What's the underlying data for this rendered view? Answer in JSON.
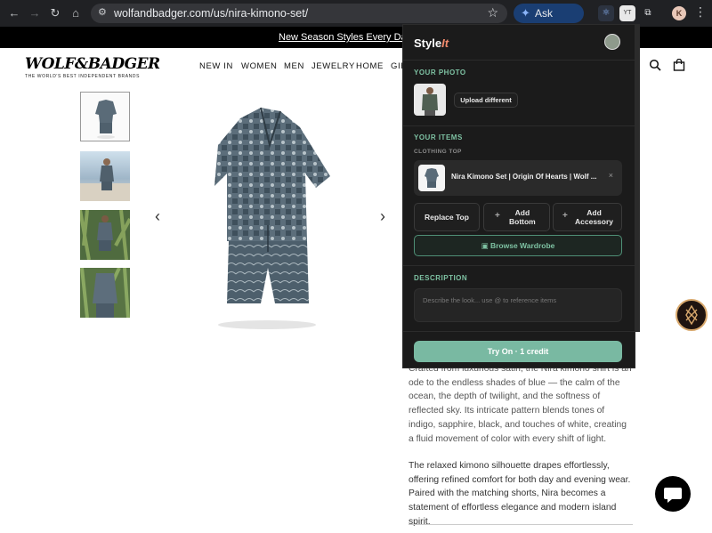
{
  "browser": {
    "url": "wolfandbadger.com/us/nira-kimono-set/",
    "gemini_label": "Ask Gemini",
    "profile_initial": "K",
    "extension_badge": "YT"
  },
  "site": {
    "promo_text": "New Season Styles Every Day. Discover Now",
    "logo_text": "WOLF&BADGER",
    "logo_tagline": "THE WORLD'S BEST INDEPENDENT BRANDS",
    "nav": [
      "NEW IN",
      "WOMEN",
      "MEN",
      "JEWELRY",
      "HOME",
      "GIFTS"
    ],
    "description_p1": "Crafted from luxurious satin, the Nira kimono shirt is an ode to the endless shades of blue — the calm of the ocean, the depth of twilight, and the softness of reflected sky. Its intricate pattern blends tones of indigo, sapphire, black, and touches of white, creating a fluid movement of color with every shift of light.",
    "description_p2": "The relaxed kimono silhouette drapes effortlessly, offering refined comfort for both day and evening wear. Paired with the matching shorts, Nira becomes a statement of effortless elegance and modern island spirit."
  },
  "popup": {
    "brand_prefix": "Style",
    "brand_suffix": "It",
    "your_photo_heading": "YOUR PHOTO",
    "upload_label": "Upload different",
    "your_items_heading": "YOUR ITEMS",
    "clothing_top_label": "CLOTHING TOP",
    "item_title": "Nira Kimono Set | Origin Of Hearts | Wolf ...",
    "replace_top_label": "Replace Top",
    "add_bottom_label": "Add\nBottom",
    "add_accessory_label": "Add\nAccessory",
    "browse_wardrobe_label": "Browse Wardrobe",
    "description_heading": "DESCRIPTION",
    "description_placeholder": "Describe the look... use @ to reference items",
    "try_on_label": "Try On · 1 credit"
  },
  "colors": {
    "accent_green": "#7ec2a3",
    "try_on_button": "#79b9a2",
    "popup_bg": "#1b1b1b",
    "gemini_bg": "#1a3e73"
  }
}
